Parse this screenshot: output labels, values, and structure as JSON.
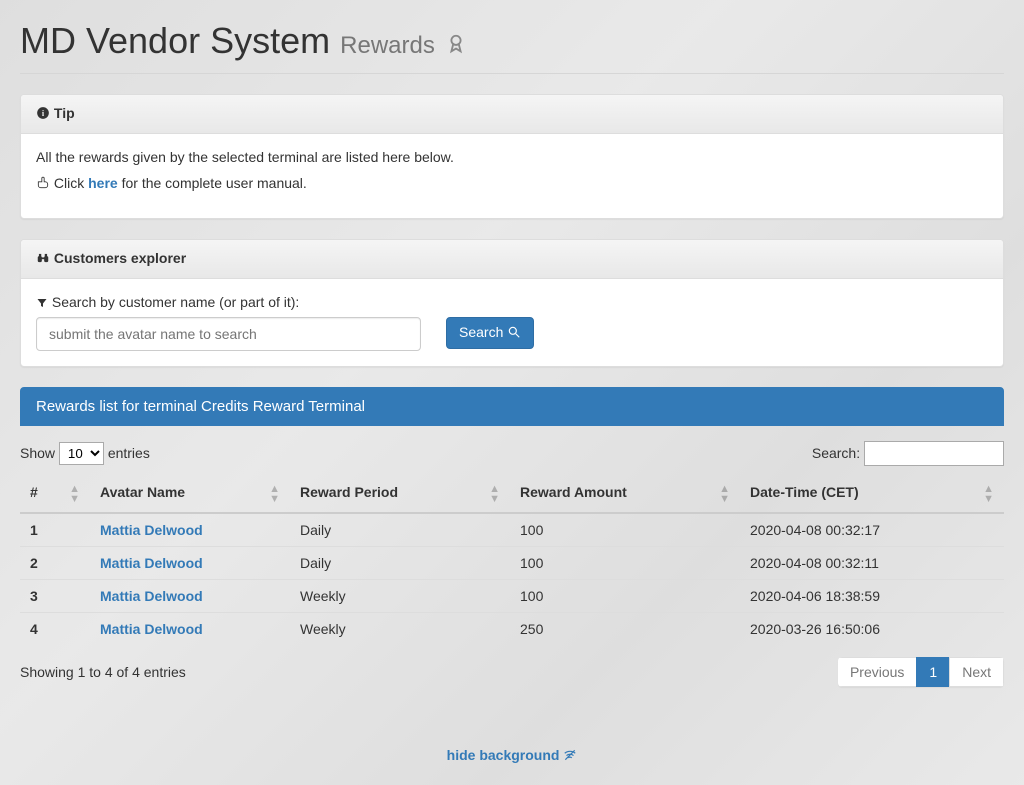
{
  "header": {
    "app_name": "MD Vendor System",
    "section": "Rewards"
  },
  "tip": {
    "title": "Tip",
    "line1": "All the rewards given by the selected terminal are listed here below.",
    "click_prefix": "Click ",
    "here": "here",
    "click_suffix": " for the complete user manual."
  },
  "explorer": {
    "title": "Customers explorer",
    "label": "Search by customer name (or part of it):",
    "placeholder": "submit the avatar name to search",
    "search_btn": "Search"
  },
  "list": {
    "title": "Rewards list for terminal Credits Reward Terminal",
    "show_prefix": "Show",
    "show_suffix": "entries",
    "page_size": "10",
    "search_label": "Search:",
    "search_value": "",
    "columns": [
      "#",
      "Avatar Name",
      "Reward Period",
      "Reward Amount",
      "Date-Time (CET)"
    ],
    "rows": [
      {
        "n": "1",
        "avatar": "Mattia Delwood",
        "period": "Daily",
        "amount": "100",
        "dt": "2020-04-08 00:32:17"
      },
      {
        "n": "2",
        "avatar": "Mattia Delwood",
        "period": "Daily",
        "amount": "100",
        "dt": "2020-04-08 00:32:11"
      },
      {
        "n": "3",
        "avatar": "Mattia Delwood",
        "period": "Weekly",
        "amount": "100",
        "dt": "2020-04-06 18:38:59"
      },
      {
        "n": "4",
        "avatar": "Mattia Delwood",
        "period": "Weekly",
        "amount": "250",
        "dt": "2020-03-26 16:50:06"
      }
    ],
    "info": "Showing 1 to 4 of 4 entries",
    "prev": "Previous",
    "next": "Next",
    "page": "1"
  },
  "footer": {
    "hide_bg": "hide background"
  }
}
